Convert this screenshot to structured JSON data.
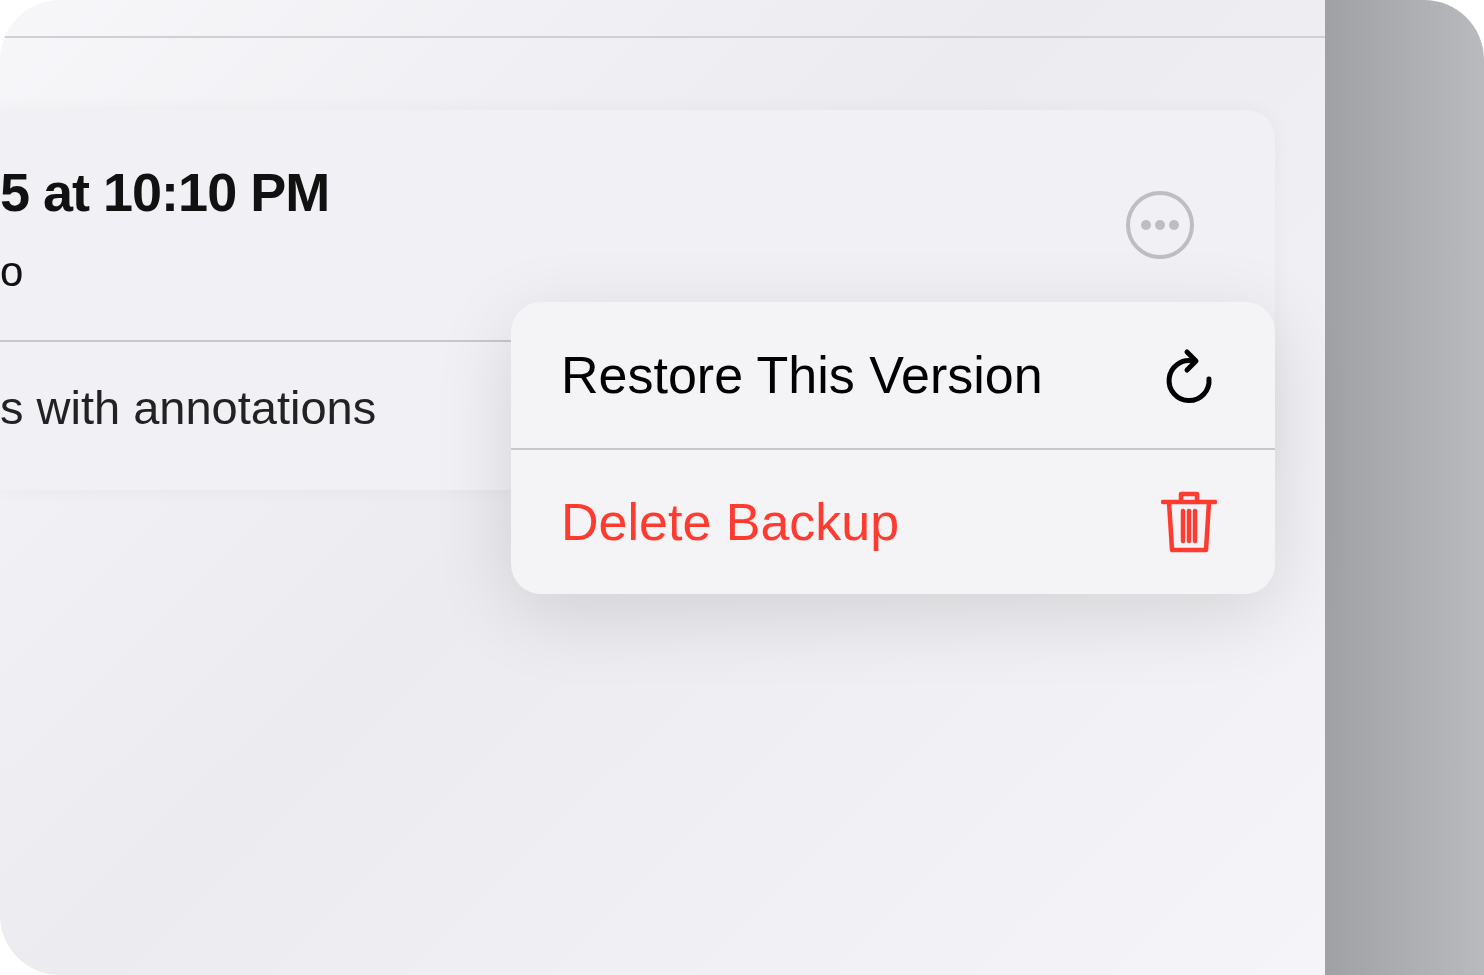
{
  "card": {
    "title": "5 at 10:10 PM",
    "subtitle": "o",
    "detail": "s with annotations"
  },
  "menu": {
    "items": [
      {
        "label": "Restore This Version",
        "kind": "default"
      },
      {
        "label": "Delete Backup",
        "kind": "destructive"
      }
    ]
  }
}
